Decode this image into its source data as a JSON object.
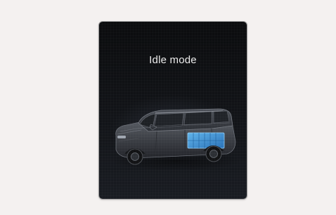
{
  "status": {
    "mode_label": "Idle mode"
  },
  "vehicle": {
    "icon": "vehicle-top-view-icon",
    "battery_icon": "battery-pack-icon",
    "body_color": "#3a3d42",
    "battery_color": "#2f86c9"
  },
  "colors": {
    "page_background": "#f4f1f0",
    "screen_background": "#0d0e11",
    "text": "#ededed"
  }
}
